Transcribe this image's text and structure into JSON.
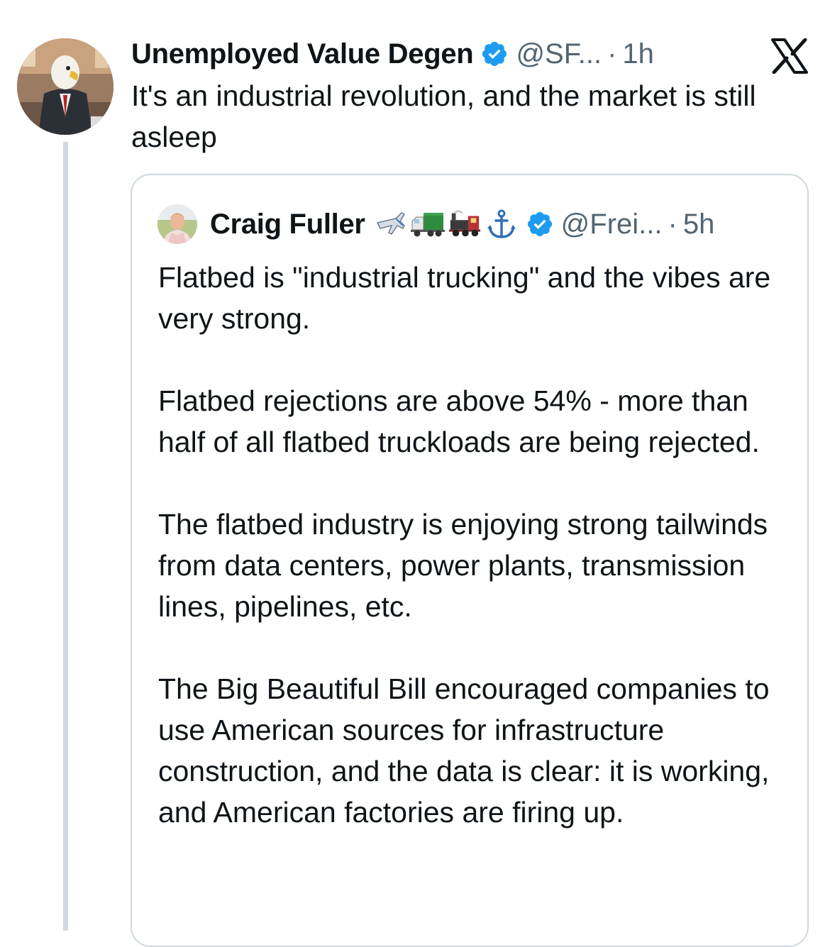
{
  "tweet": {
    "author": {
      "display_name": "Unemployed Value Degen",
      "handle": "@SF...",
      "time": "1h",
      "verified": true,
      "avatar_icon": "eagle-in-suit-avatar"
    },
    "text": "It's an industrial revolution, and the market is still asleep",
    "platform_icon": "x-logo-icon"
  },
  "quoted_tweet": {
    "author": {
      "display_name": "Craig Fuller",
      "handle": "@Frei...",
      "time": "5h",
      "verified": true,
      "name_emojis": [
        "airplane-icon",
        "truck-icon",
        "locomotive-icon",
        "anchor-icon"
      ]
    },
    "paragraphs": [
      "Flatbed is \"industrial trucking\" and the vibes are very strong.",
      "Flatbed rejections are above 54% - more than half of all flatbed truckloads are being rejected.",
      "The flatbed industry is enjoying strong tailwinds from data centers, power plants, transmission lines, pipelines, etc.",
      "The Big Beautiful Bill encouraged companies to use American sources for infrastructure construction, and the data is clear: it is working, and American factories are firing up."
    ]
  },
  "colors": {
    "text_primary": "#0f1419",
    "text_muted": "#536471",
    "verified_blue": "#1d9bf0",
    "border": "#cfd9de"
  }
}
